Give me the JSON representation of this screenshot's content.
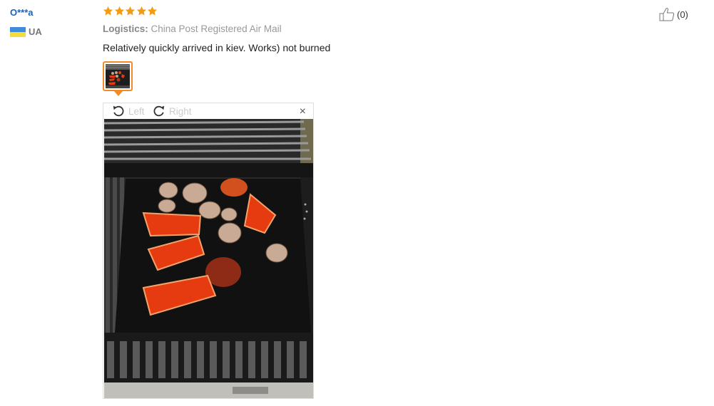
{
  "review": {
    "user_name": "O***a",
    "country_code": "UA",
    "rating_stars": 5,
    "logistics_label": "Logistics:",
    "logistics_value": "China Post Registered Air Mail",
    "text": "Relatively quickly arrived in kiev. Works) not burned",
    "like_count": "(0)"
  },
  "viewer": {
    "rotate_left_label": "Left",
    "rotate_right_label": "Right",
    "close_label": "×"
  },
  "colors": {
    "star": "#f39c12",
    "accent": "#f08c28",
    "link": "#1a63b5"
  },
  "icons": [
    "star-icon",
    "flag-icon",
    "rotate-left-icon",
    "rotate-right-icon",
    "close-icon",
    "thumbs-up-icon"
  ]
}
